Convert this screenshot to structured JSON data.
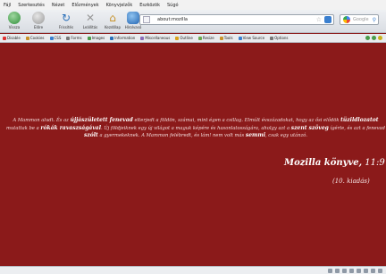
{
  "menu": [
    "Fájl",
    "Szerkesztés",
    "Nézet",
    "Előzmények",
    "Könyvjelzők",
    "Eszközök",
    "Súgó"
  ],
  "nav": {
    "back": "Vissza",
    "forward": "Előre",
    "reload": "Frissítés",
    "stop": "Leállítás",
    "home": "Kezdőlap",
    "news": "Hírolvasó"
  },
  "url": {
    "value": "about:mozilla"
  },
  "search": {
    "placeholder": "Google"
  },
  "devbar": [
    "Disable",
    "Cookies",
    "CSS",
    "Forms",
    "Images",
    "Information",
    "Miscellaneous",
    "Outline",
    "Resize",
    "Tools",
    "View Source",
    "Options"
  ],
  "content": {
    "q1": "A Mammon aludt. És az",
    "q1b": "újjászületett fenevad",
    "q2": "elterjedt a földön, számai, mint égen a csillag. Elmúlt évszázadokat, hogy az ősi elődök",
    "q3b": "tüzildlozatot",
    "q4": "mutattak be a",
    "q5b": "rókák ravaszságával",
    "q6": ". Új földjeiknek egy új világot a maguk képére és hasonlatosságára, aholgy",
    "q7": "azt a",
    "q8b": "szent szöveg",
    "q9": "ígérte, és azt a fenevad",
    "q10b": "szólt",
    "q11": "a gyermekeknek. A Mammon felébredt, és lám! nem volt más",
    "q12b": "semmi",
    "q13": ", csak egy",
    "q14": "utánzó.",
    "sig_book": "Mozilla könyve,",
    "sig_verse": "11:9",
    "edition": "(10. kiadás)"
  }
}
